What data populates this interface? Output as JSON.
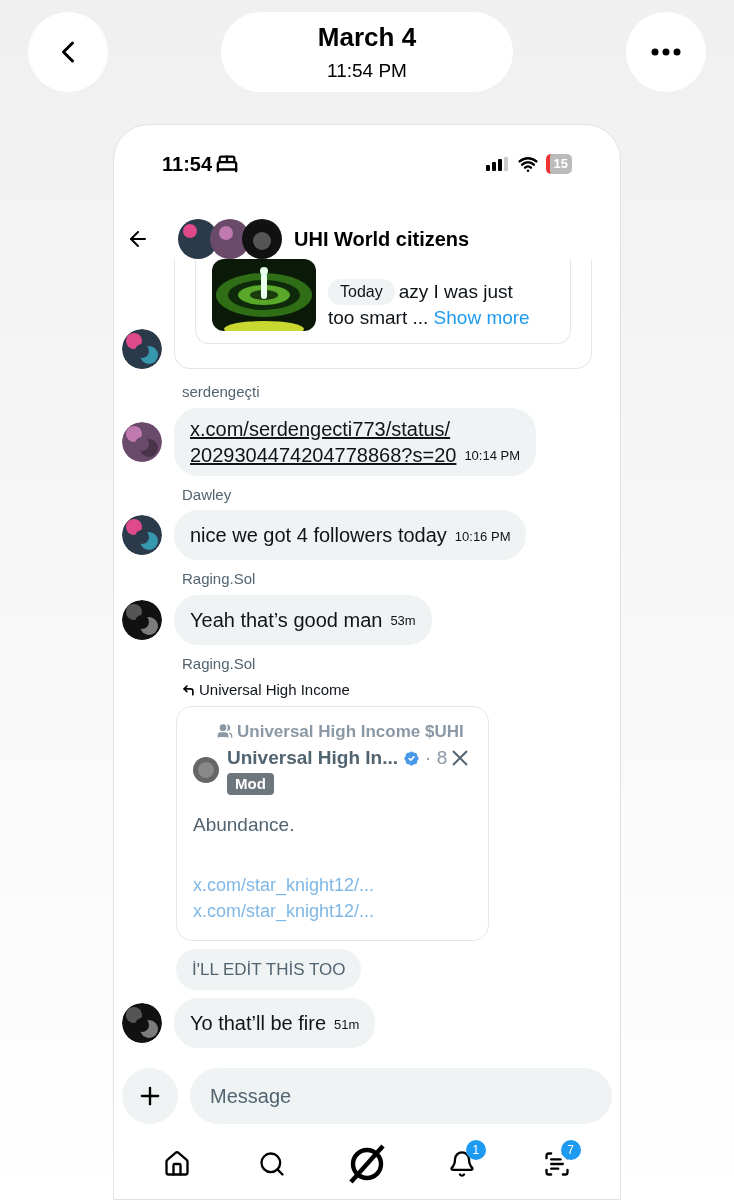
{
  "viewer": {
    "date": "March 4",
    "time": "11:54 PM"
  },
  "status_bar": {
    "time": "11:54",
    "battery": "15"
  },
  "chat": {
    "title": "UHI World citizens"
  },
  "preview": {
    "lines": [
      "azy I was just",
      "too smart ..."
    ],
    "show_more": "Show more",
    "day_label": "Today"
  },
  "messages": [
    {
      "kind": "link",
      "sender": "serdengeçti",
      "lines": [
        "x.com/serdengecti773/status/",
        "2029304474204778868?s=20"
      ],
      "time": "10:14 PM"
    },
    {
      "kind": "text",
      "sender": "Dawley",
      "text": "nice we got 4 followers today",
      "time": "10:16 PM"
    },
    {
      "kind": "text",
      "sender": "Raging.Sol",
      "text": "Yeah that’s good man",
      "time": "53m"
    },
    {
      "kind": "quote",
      "sender": "Raging.Sol",
      "reply_to": "Universal High Income",
      "community": "Universal High Income $UHI",
      "author": "Universal High In...",
      "verified": true,
      "age": "· 8",
      "badge": "Mod",
      "body": "Abundance.",
      "links": [
        "x.com/star_knight12/...",
        "x.com/star_knight12/..."
      ]
    },
    {
      "kind": "caps",
      "text": "İ'LL EDİT THİS TOO"
    },
    {
      "kind": "text",
      "text": "Yo that’ll be fire",
      "time": "51m"
    }
  ],
  "composer": {
    "placeholder": "Message"
  },
  "nav": {
    "notifications_badge": "1",
    "messages_badge": "7"
  }
}
